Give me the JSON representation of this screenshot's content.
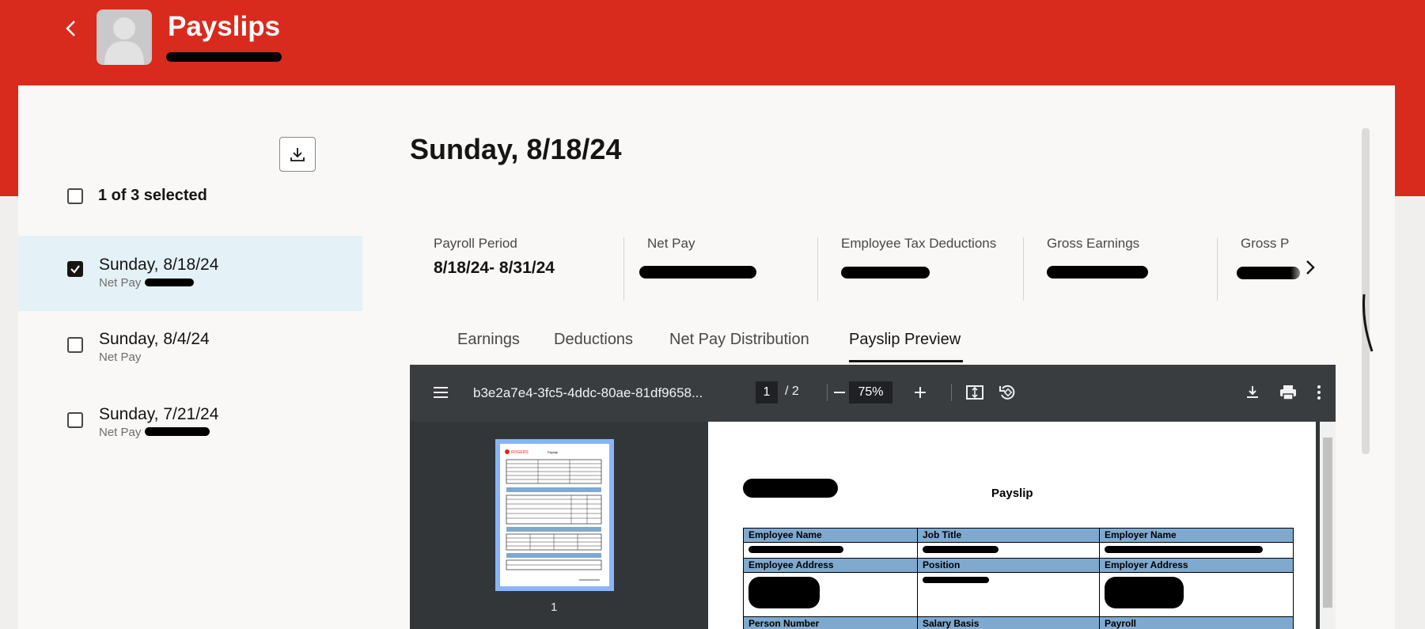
{
  "header": {
    "title": "Payslips",
    "back_icon": "chevron-left-icon",
    "subtitle_redacted": true
  },
  "sidebar": {
    "download_icon": "download-icon",
    "selection_label": "1 of 3 selected",
    "items": [
      {
        "date": "Sunday, 8/18/24",
        "sub": "Net Pay",
        "checked": true
      },
      {
        "date": "Sunday, 8/4/24",
        "sub": "Net Pay",
        "checked": false
      },
      {
        "date": "Sunday, 7/21/24",
        "sub": "Net Pay",
        "checked": false
      }
    ]
  },
  "main": {
    "title": "Sunday, 8/18/24",
    "metrics": [
      {
        "label": "Payroll Period",
        "value": "8/18/24- 8/31/24"
      },
      {
        "label": "Net Pay",
        "value": ""
      },
      {
        "label": "Employee Tax Deductions",
        "value": ""
      },
      {
        "label": "Gross Earnings",
        "value": ""
      },
      {
        "label": "Gross P",
        "value": ""
      }
    ],
    "tabs": [
      "Earnings",
      "Deductions",
      "Net Pay Distribution",
      "Payslip Preview"
    ],
    "active_tab": "Payslip Preview"
  },
  "viewer": {
    "file_name": "b3e2a7e4-3fc5-4ddc-80ae-81df9658...",
    "page_current": "1",
    "page_total": "/ 2",
    "zoom": "75%",
    "thumbnail_label": "1",
    "document": {
      "heading": "Payslip",
      "thumb_brand": "ROGERS",
      "rows": [
        [
          "Employee Name",
          "Job Title",
          "Employer Name"
        ],
        [
          "Employee Address",
          "Position",
          "Employer Address"
        ],
        [
          "Person Number",
          "Salary Basis",
          "Payroll"
        ]
      ]
    }
  },
  "colors": {
    "brand": "#d92a1e",
    "selected_row": "#e4f1f7",
    "viewer_bg": "#323639",
    "table_header": "#7fa9cf"
  }
}
